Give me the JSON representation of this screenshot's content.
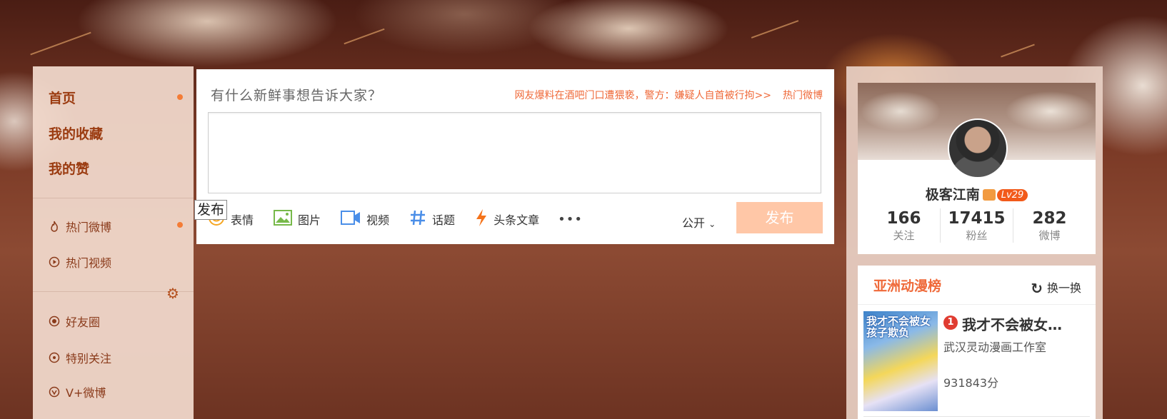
{
  "leftnav": {
    "main": [
      "首页",
      "我的收藏",
      "我的赞"
    ],
    "sub": [
      {
        "label": "热门微博",
        "icon": "flame-icon"
      },
      {
        "label": "热门视频",
        "icon": "play-circle-icon"
      },
      {
        "label": "好友圈",
        "icon": "target-circle-icon"
      },
      {
        "label": "特别关注",
        "icon": "dot-circle-icon"
      },
      {
        "label": "V+微博",
        "icon": "v-circle-icon"
      }
    ]
  },
  "composer": {
    "prompt": "有什么新鲜事想告诉大家？",
    "hot_headline": "网友爆料在酒吧门口遭猥亵，警方：嫌疑人自首被行拘>>",
    "hot_link": "热门微博",
    "tools": [
      {
        "label": "表情",
        "icon": "emoji-icon"
      },
      {
        "label": "图片",
        "icon": "image-icon"
      },
      {
        "label": "视频",
        "icon": "video-icon"
      },
      {
        "label": "话题",
        "icon": "hashtag-icon"
      },
      {
        "label": "头条文章",
        "icon": "lightning-icon"
      }
    ],
    "more": "•••",
    "visibility": "公开",
    "publish": "发布",
    "tooltip": "发布"
  },
  "profile": {
    "name": "极客江南",
    "level": "Lv29",
    "stats": [
      {
        "num": "166",
        "label": "关注"
      },
      {
        "num": "17415",
        "label": "粉丝"
      },
      {
        "num": "282",
        "label": "微博"
      }
    ]
  },
  "ranking": {
    "title": "亚洲动漫榜",
    "refresh": "换一换",
    "item": {
      "rank": "1",
      "name": "我才不会被女…",
      "studio": "武汉灵动漫画工作室",
      "score": "931843分",
      "cover_text": "我才不会被女孩子欺负"
    }
  },
  "colors": {
    "accent": "#ef6a3a",
    "nav_text": "#9b3b10",
    "publish_bg": "#ffc7a7",
    "dot": "#f47c36"
  }
}
